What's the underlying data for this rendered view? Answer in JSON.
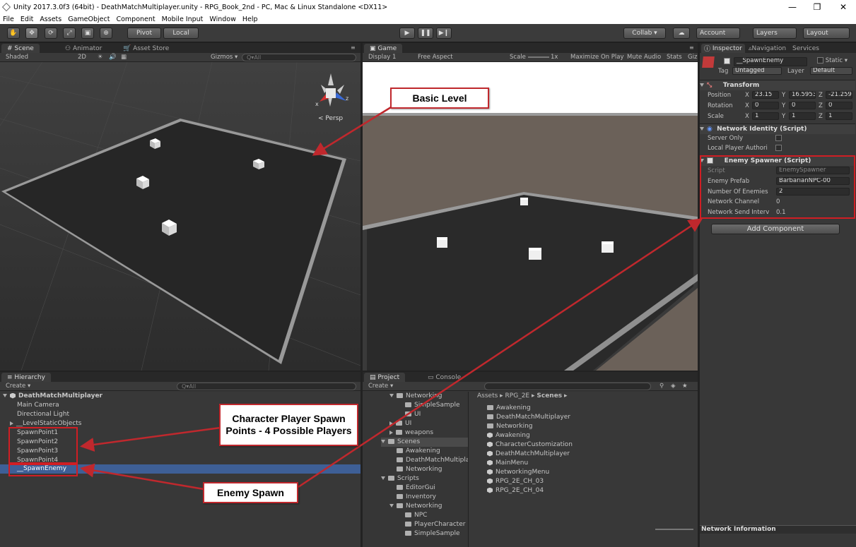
{
  "window": {
    "title": "Unity 2017.3.0f3 (64bit) - DeathMatchMultiplayer.unity - RPG_Book_2nd - PC, Mac & Linux Standalone <DX11>",
    "min": "—",
    "max": "❐",
    "close": "✕"
  },
  "menu": [
    "File",
    "Edit",
    "Assets",
    "GameObject",
    "Component",
    "Mobile Input",
    "Window",
    "Help"
  ],
  "toolbar": {
    "pivot": "Pivot",
    "local": "Local",
    "collab": "Collab ▾",
    "account": "Account",
    "layers": "Layers",
    "layout": "Layout"
  },
  "scene": {
    "tabs": [
      "Scene",
      "Animator",
      "Asset Store"
    ],
    "shaded": "Shaded",
    "mode2d": "2D",
    "gizmos": "Gizmos ▾",
    "search": "Q▾All",
    "persp": "< Persp",
    "gizmo_x": "x",
    "gizmo_z": "z"
  },
  "game": {
    "tab": "Game",
    "display": "Display 1",
    "aspect": "Free Aspect",
    "scale": "Scale",
    "scale_val": "1x",
    "maximize": "Maximize On Play",
    "mute": "Mute Audio",
    "stats": "Stats",
    "gizmos": "Giz"
  },
  "hierarchy": {
    "tab": "Hierarchy",
    "create": "Create ▾",
    "search": "Q▾All",
    "scene": "DeathMatchMultiplayer",
    "items": [
      "Main Camera",
      "Directional Light",
      "__LevelStaticObjects",
      "SpawnPoint1",
      "SpawnPoint2",
      "SpawnPoint3",
      "SpawnPoint4",
      "__SpawnEnemy"
    ]
  },
  "project": {
    "tabs": [
      "Project",
      "Console"
    ],
    "create": "Create ▾",
    "breadcrumb": [
      "Assets",
      "RPG_2E",
      "Scenes"
    ],
    "tree": [
      "Networking",
      "SimpleSample",
      "UI",
      "UI",
      "weapons",
      "Scenes",
      "Awakening",
      "DeathMatchMultipla",
      "Networking",
      "Scripts",
      "EditorGui",
      "Inventory",
      "Networking",
      "NPC",
      "PlayerCharacter",
      "SimpleSample"
    ],
    "files": [
      "Awakening",
      "DeathMatchMultiplayer",
      "Networking",
      "Awakening",
      "CharacterCustomization",
      "DeathMatchMultiplayer",
      "MainMenu",
      "NetworkingMenu",
      "RPG_2E_CH_03",
      "RPG_2E_CH_04"
    ]
  },
  "inspector": {
    "tabs": [
      "Inspector",
      "Navigation",
      "Services"
    ],
    "name": "__SpawnEnemy",
    "static": "Static ▾",
    "tag_label": "Tag",
    "tag": "Untagged",
    "layer_label": "Layer",
    "layer": "Default",
    "transform": {
      "title": "Transform",
      "position_label": "Position",
      "rotation_label": "Rotation",
      "scale_label": "Scale",
      "pos": [
        "23.15",
        "16.5953",
        "-21.259"
      ],
      "rot": [
        "0",
        "0",
        "0"
      ],
      "scl": [
        "1",
        "1",
        "1"
      ]
    },
    "netid": {
      "title": "Network Identity (Script)",
      "server_only": "Server Only",
      "local_player": "Local Player Authori"
    },
    "spawner": {
      "title": "Enemy Spawner (Script)",
      "script_label": "Script",
      "script": "EnemySpawner",
      "prefab_label": "Enemy Prefab",
      "prefab": "BarbarianNPC-00",
      "count_label": "Number Of Enemies",
      "count": "2",
      "channel_label": "Network Channel",
      "channel": "0",
      "interval_label": "Network Send Interv",
      "interval": "0.1"
    },
    "add_component": "Add Component",
    "footer": "Network Information"
  },
  "callouts": {
    "basic_level": "Basic Level",
    "spawn_points": "Character Player Spawn Points - 4 Possible Players",
    "enemy_spawn": "Enemy Spawn"
  },
  "colors": {
    "accent": "#c0282d",
    "selection": "#3e5f96"
  }
}
